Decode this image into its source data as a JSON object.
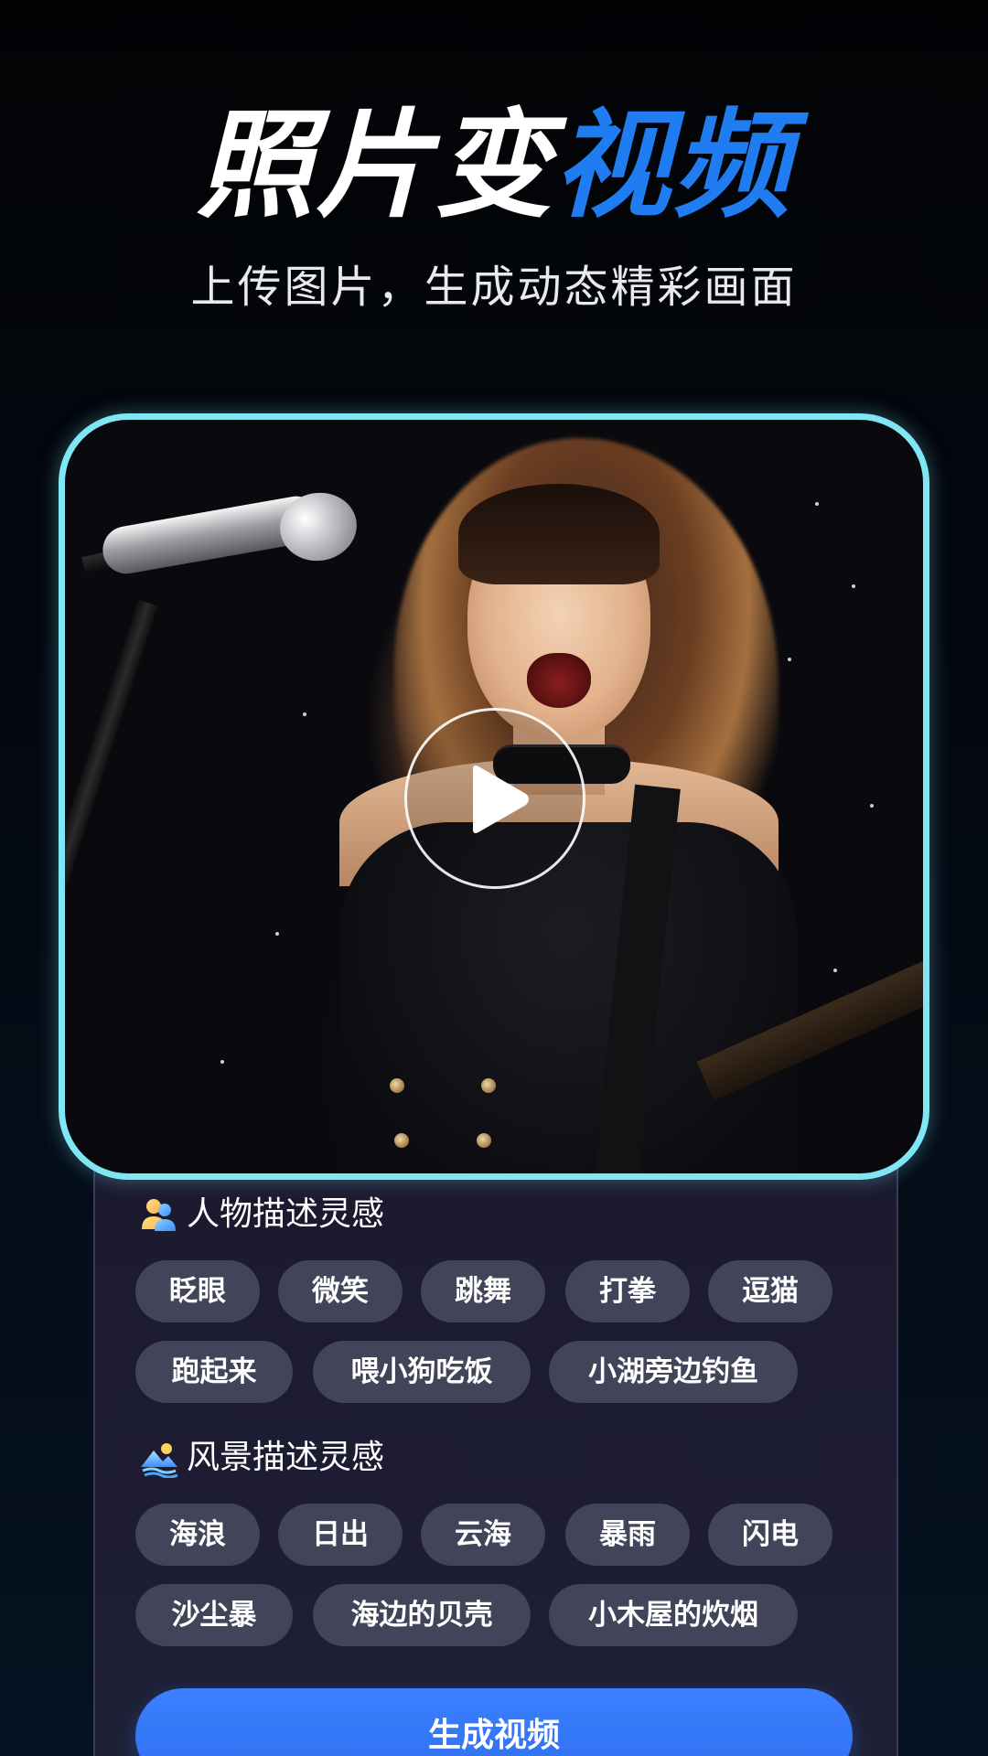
{
  "header": {
    "title_white": "照片变",
    "title_blue": "视频",
    "subtitle": "上传图片，生成动态精彩画面"
  },
  "hero": {
    "play_icon": "play-icon",
    "border_color": "#7fe6f4"
  },
  "people_section": {
    "title": "人物描述灵感",
    "icon": "people-icon",
    "chips": [
      "眨眼",
      "微笑",
      "跳舞",
      "打拳",
      "逗猫",
      "跑起来",
      "喂小狗吃饭",
      "小湖旁边钓鱼"
    ]
  },
  "scenery_section": {
    "title": "风景描述灵感",
    "icon": "landscape-icon",
    "chips": [
      "海浪",
      "日出",
      "云海",
      "暴雨",
      "闪电",
      "沙尘暴",
      "海边的贝壳",
      "小木屋的炊烟"
    ]
  },
  "actions": {
    "generate_label": "生成视频"
  },
  "colors": {
    "accent_blue": "#1f7cf1",
    "button_blue": "#3b80ff",
    "chip_bg": "#42445a",
    "panel_bg": "#1b1a2e"
  }
}
